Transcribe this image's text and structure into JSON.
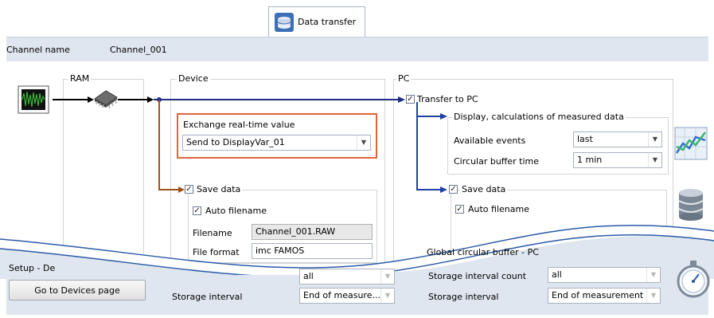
{
  "tab": {
    "label": "Data transfer",
    "icon": "database-transfer-icon"
  },
  "channel": {
    "name_label": "Channel name",
    "name_value": "Channel_001"
  },
  "groups": {
    "ram": "RAM",
    "device": "Device",
    "pc": "PC"
  },
  "device": {
    "exchange_label": "Exchange real-time value",
    "exchange_value": "Send to DisplayVar_01",
    "save_data_label": "Save data",
    "auto_filename_label": "Auto filename",
    "filename_label": "Filename",
    "filename_value": "Channel_001.RAW",
    "file_format_label": "File format",
    "file_format_value": "imc FAMOS"
  },
  "pc": {
    "transfer_label": "Transfer to PC",
    "display_group_label": "Display, calculations of measured data",
    "available_events_label": "Available events",
    "available_events_value": "last",
    "circular_buffer_label": "Circular buffer time",
    "circular_buffer_value": "1 min",
    "save_data_label": "Save data",
    "auto_filename_label": "Auto filename"
  },
  "bottom": {
    "setup_label": "Setup - De",
    "goto_button": "Go to Devices page",
    "device_count_value": "all",
    "device_interval_label": "Storage interval",
    "device_interval_value": "End of measure...",
    "global_buffer_label": "Global circular buffer - PC",
    "pc_count_label": "Storage interval count",
    "pc_count_value": "all",
    "pc_interval_label": "Storage interval",
    "pc_interval_value": "End of measurement"
  },
  "colors": {
    "device_line": "#1f2c86",
    "save_line": "#a0521a",
    "pc_line": "#1f3fa6",
    "highlight": "#e0663a"
  }
}
